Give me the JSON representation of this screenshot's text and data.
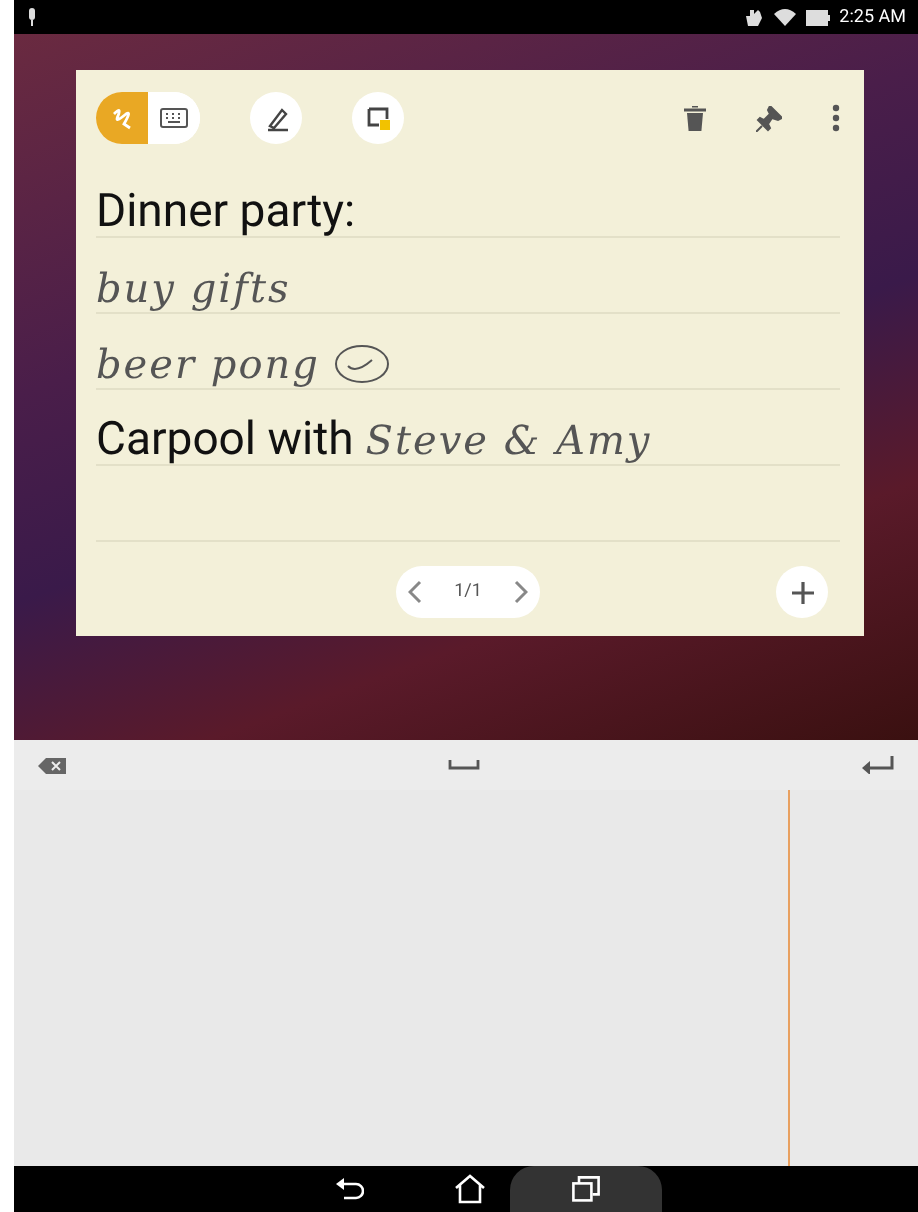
{
  "status_bar": {
    "time": "2:25 AM"
  },
  "note": {
    "input_modes": [
      {
        "kind": "handwriting",
        "selected": true
      },
      {
        "kind": "keyboard",
        "selected": false
      }
    ],
    "lines": [
      {
        "kind": "text",
        "segments": [
          {
            "kind": "typed",
            "text": "Dinner party:"
          }
        ]
      },
      {
        "kind": "text",
        "segments": [
          {
            "kind": "ink",
            "text": "buy gifts"
          }
        ]
      },
      {
        "kind": "text",
        "segments": [
          {
            "kind": "ink",
            "text": "beer pong"
          },
          {
            "kind": "check"
          }
        ]
      },
      {
        "kind": "text",
        "segments": [
          {
            "kind": "typed",
            "text": "Carpool with"
          },
          {
            "kind": "ink",
            "text": "Steve & Amy"
          }
        ]
      },
      {
        "kind": "blank"
      }
    ],
    "page": "1/1"
  }
}
